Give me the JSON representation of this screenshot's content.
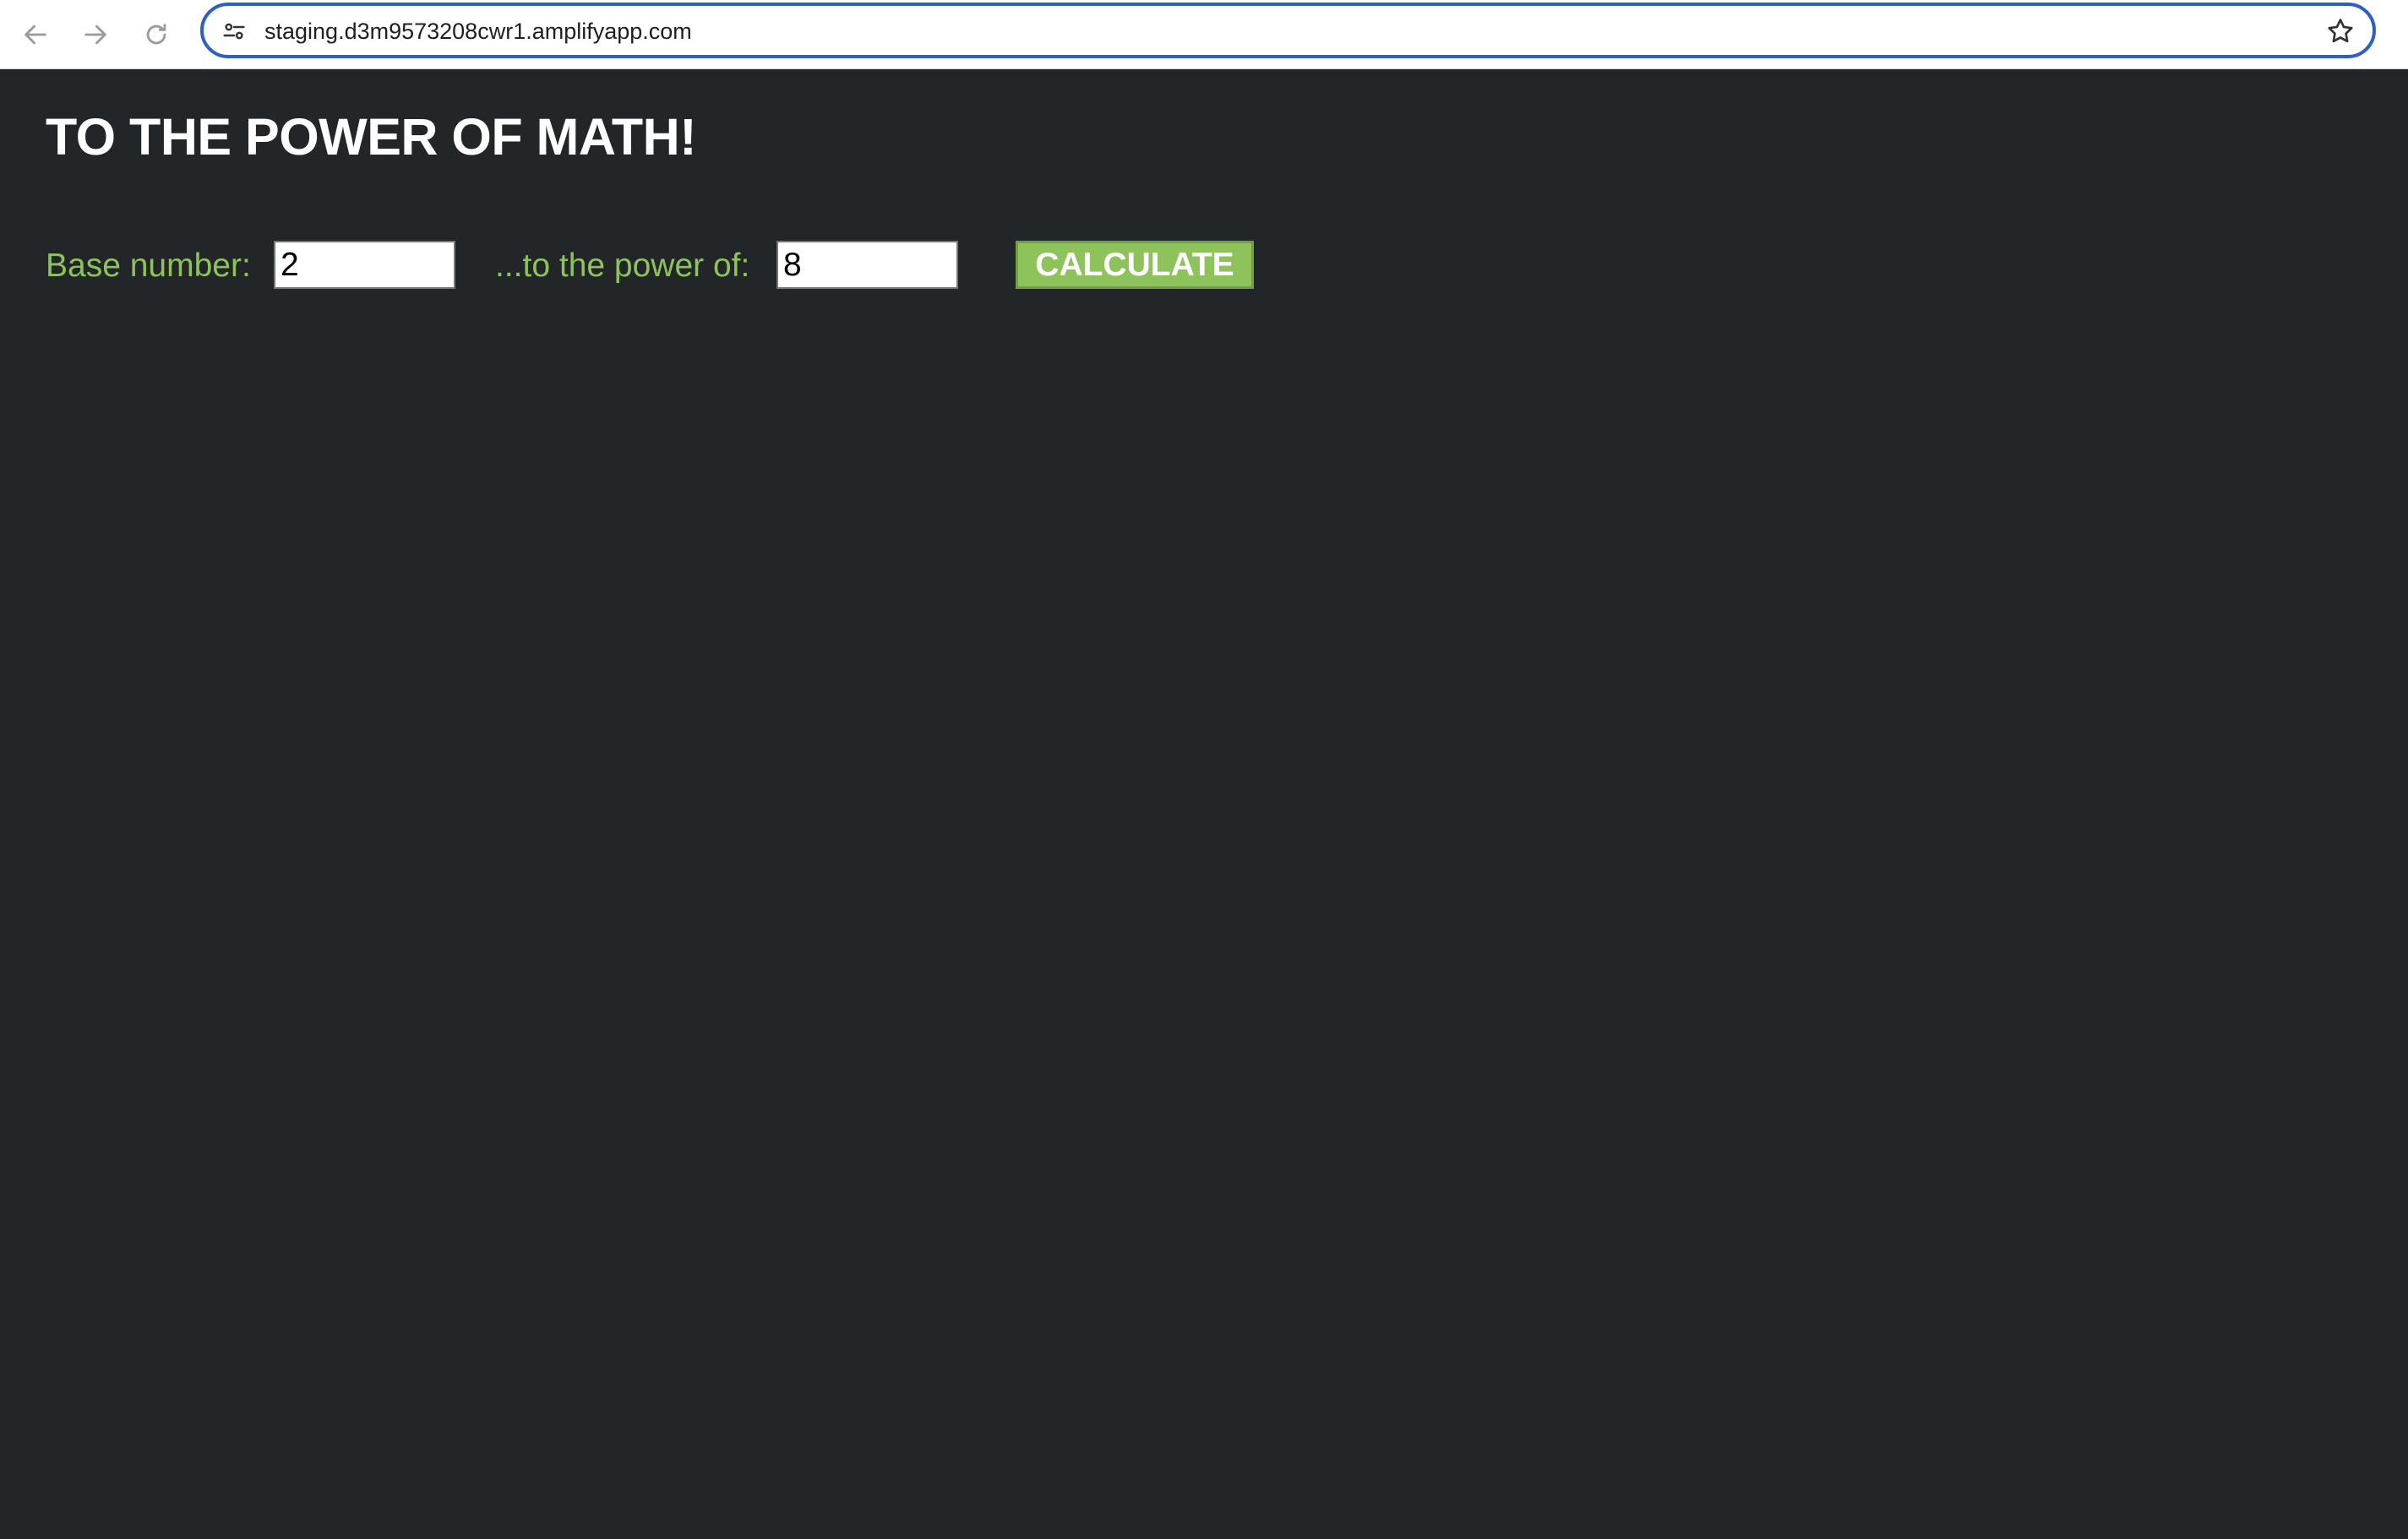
{
  "browser": {
    "url": "staging.d3m9573208cwr1.amplifyapp.com",
    "icons": {
      "back": "arrow-left-icon",
      "forward": "arrow-right-icon",
      "reload": "reload-icon",
      "site_info": "tune-icon",
      "bookmark": "star-icon"
    }
  },
  "page": {
    "title": "TO THE POWER OF MATH!",
    "form": {
      "base_label": "Base number:",
      "base_value": "2",
      "power_label": "...to the power of:",
      "power_value": "8",
      "calculate_label": "CALCULATE"
    }
  },
  "colors": {
    "background": "#232629",
    "accent": "#8dc35a",
    "heading": "#ffffff",
    "omnibox_focus": "#2d5fc7"
  }
}
